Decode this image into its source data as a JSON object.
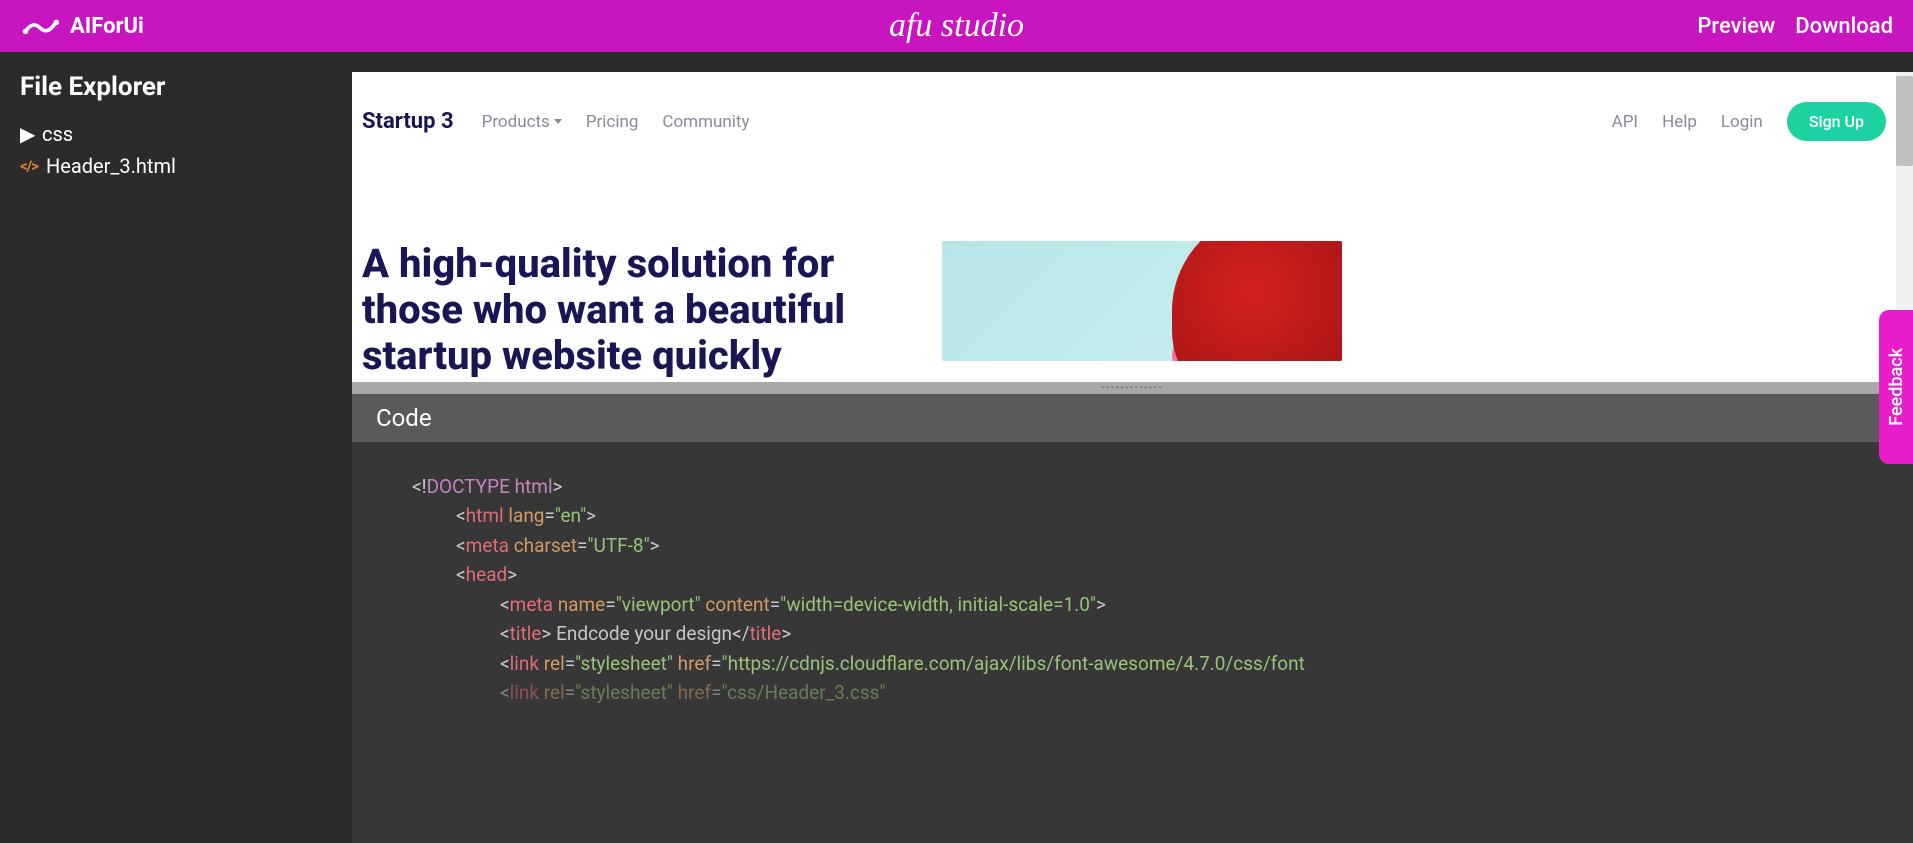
{
  "topbar": {
    "brand": "AIForUi",
    "studio": "afu studio",
    "preview": "Preview",
    "download": "Download"
  },
  "sidebar": {
    "title": "File Explorer",
    "folder": "css",
    "file": "Header_3.html"
  },
  "preview": {
    "brand": "Startup 3",
    "nav": {
      "products": "Products",
      "pricing": "Pricing",
      "community": "Community",
      "api": "API",
      "help": "Help",
      "login": "Login",
      "signup": "Sign Up"
    },
    "headline": "A high-quality solution for those who want a beautiful startup website quickly"
  },
  "divider": "-------------",
  "code": {
    "title": "Code",
    "lines": {
      "doctype_open": "<!",
      "doctype": "DOCTYPE html",
      "doctype_close": ">",
      "html_tag": "html",
      "lang_attr": "lang",
      "lang_val": "\"en\"",
      "meta_tag": "meta",
      "charset_attr": "charset",
      "charset_val": "\"UTF-8\"",
      "head_tag": "head",
      "name_attr": "name",
      "viewport_val": "\"viewport\"",
      "content_attr": "content",
      "content_val": "\"width=device-width, initial-scale=1.0\"",
      "title_tag": "title",
      "title_text": " Endcode your design",
      "link_tag": "link",
      "rel_attr": "rel",
      "stylesheet_val": "\"stylesheet\"",
      "href_attr": "href",
      "href_val1": "\"https://cdnjs.cloudflare.com/ajax/libs/font-awesome/4.7.0/css/font",
      "href_val2": "\"css/Header_3.css\""
    }
  },
  "feedback": "Feedback"
}
